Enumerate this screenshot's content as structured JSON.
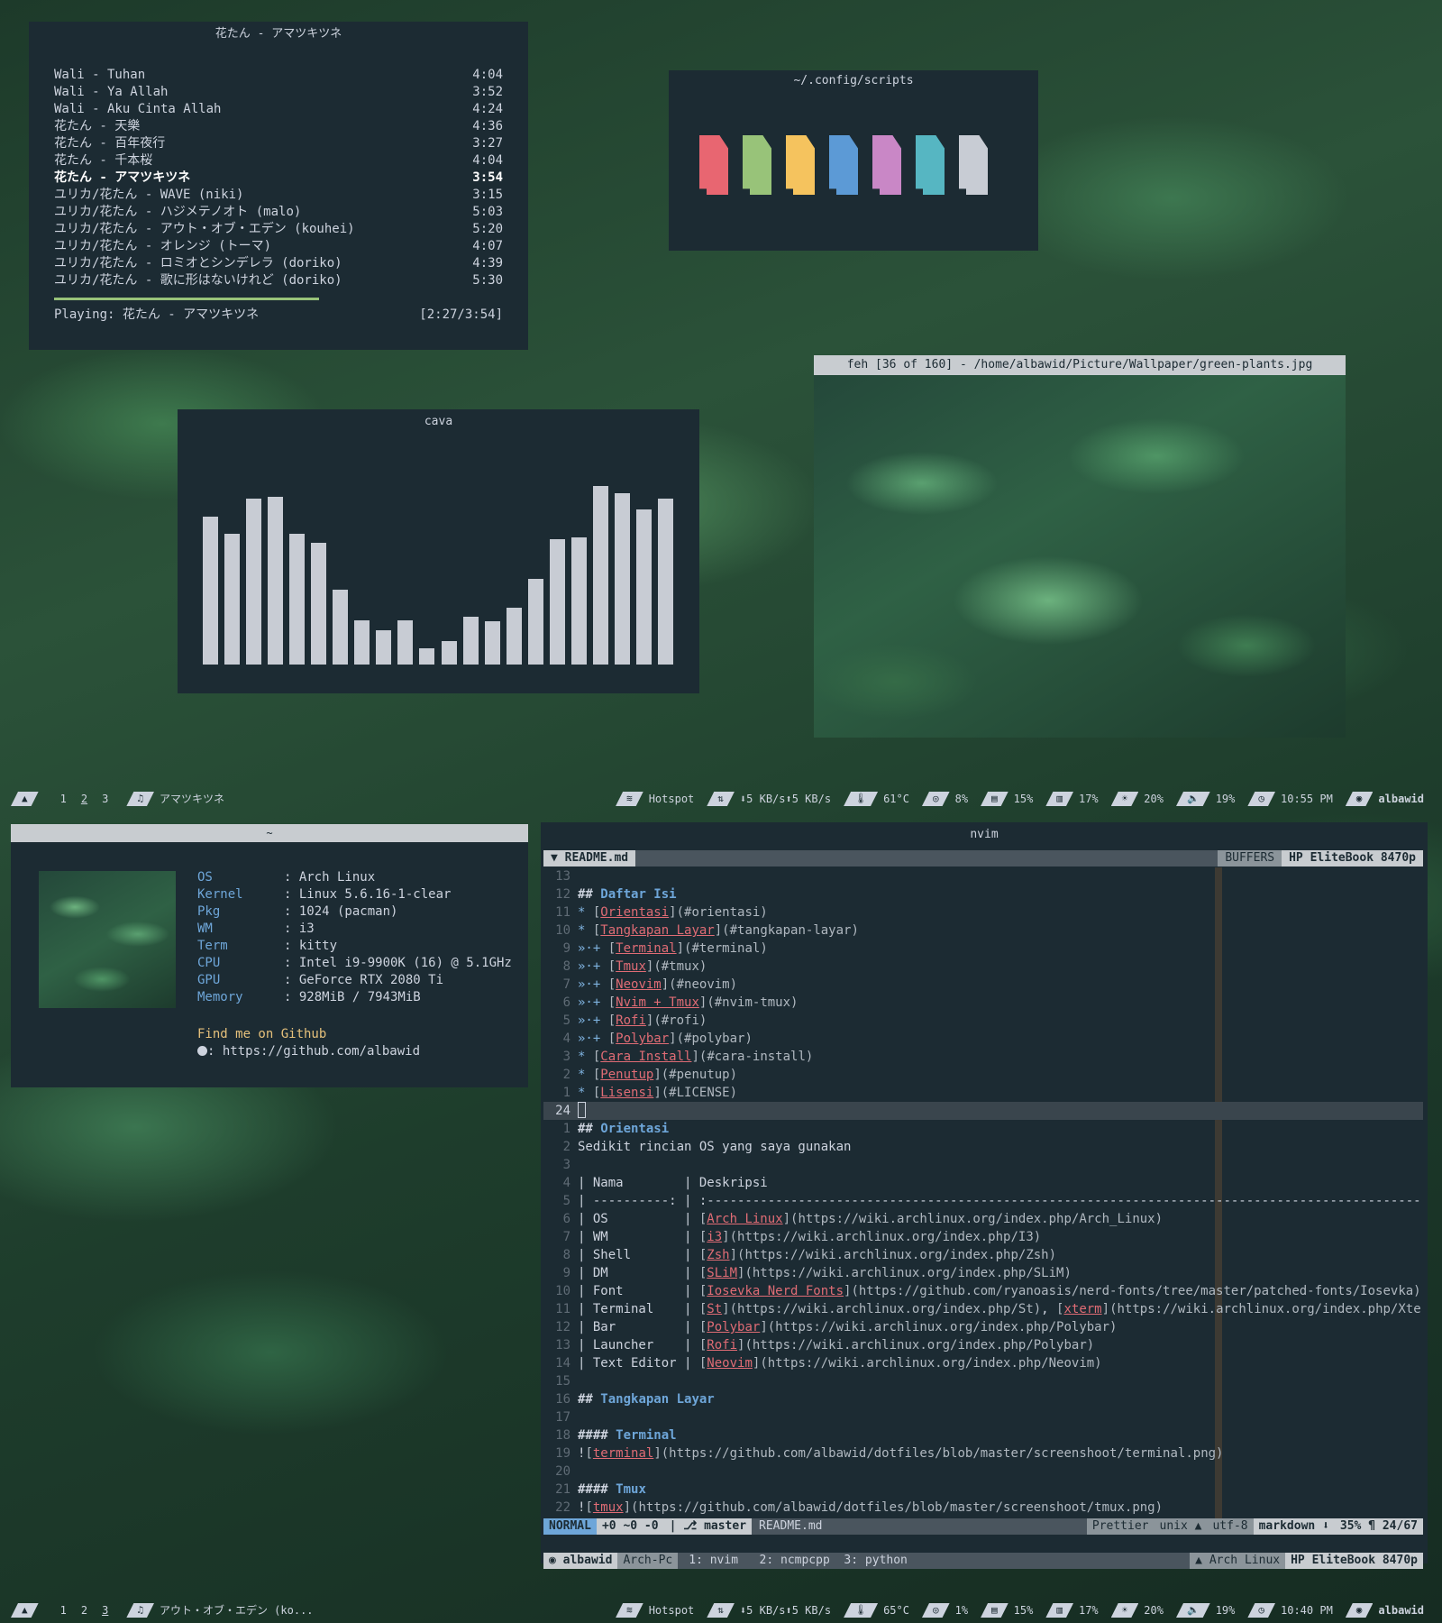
{
  "player": {
    "title": "花たん - アマツキツネ",
    "tracks": [
      {
        "name": "Wali - Tuhan",
        "time": "4:04"
      },
      {
        "name": "Wali - Ya Allah",
        "time": "3:52"
      },
      {
        "name": "Wali - Aku Cinta Allah",
        "time": "4:24"
      },
      {
        "name": "花たん - 天樂",
        "time": "4:36"
      },
      {
        "name": "花たん - 百年夜行",
        "time": "3:27"
      },
      {
        "name": "花たん - 千本桜",
        "time": "4:04"
      },
      {
        "name": "花たん - アマツキツネ",
        "time": "3:54",
        "active": true
      },
      {
        "name": "ユリカ/花たん - WAVE (niki)",
        "time": "3:15"
      },
      {
        "name": "ユリカ/花たん - ハジメテノオト (malo)",
        "time": "5:03"
      },
      {
        "name": "ユリカ/花たん - アウト・オブ・エデン (kouhei)",
        "time": "5:20"
      },
      {
        "name": "ユリカ/花たん - オレンジ (トーマ)",
        "time": "4:07"
      },
      {
        "name": "ユリカ/花たん - ロミオとシンデレラ (doriko)",
        "time": "4:39"
      },
      {
        "name": "ユリカ/花たん - 歌に形はないけれど (doriko)",
        "time": "5:30"
      }
    ],
    "progress": 0.59,
    "playing_label": "Playing: 花たん - アマツキツネ",
    "playing_time": "[2:27/3:54]"
  },
  "scripts": {
    "title": "~/.config/scripts",
    "colors": [
      "#e86671",
      "#98c379",
      "#f5c35e",
      "#5c9ad6",
      "#c987c6",
      "#56b6c2",
      "#c8ccd4"
    ]
  },
  "cava": {
    "title": "cava",
    "levels": [
      0.83,
      0.73,
      0.93,
      0.94,
      0.73,
      0.68,
      0.42,
      0.25,
      0.19,
      0.25,
      0.09,
      0.13,
      0.27,
      0.24,
      0.32,
      0.48,
      0.7,
      0.71,
      1.0,
      0.96,
      0.87,
      0.93
    ]
  },
  "feh": {
    "title": "feh [36 of 160] - /home/albawid/Picture/Wallpaper/green-plants.jpg"
  },
  "topbar": {
    "workspaces": [
      "1",
      "2",
      "3"
    ],
    "active_ws": 1,
    "song": "アマツキツネ",
    "wifi": "Hotspot",
    "down": "5 KB/s",
    "up": "5 KB/s",
    "temp": "61°C",
    "cpu": "8%",
    "mem": "15%",
    "disk": "17%",
    "bright": "20%",
    "vol": "19%",
    "clock": "10:55 PM",
    "user": "albawid"
  },
  "bottombar": {
    "workspaces": [
      "1",
      "2",
      "3"
    ],
    "active_ws": 2,
    "song": "アウト・オブ・エデン (ko...",
    "wifi": "Hotspot",
    "down": "5 KB/s",
    "up": "5 KB/s",
    "temp": "65°C",
    "cpu": "1%",
    "mem": "15%",
    "disk": "17%",
    "bright": "20%",
    "vol": "19%",
    "clock": "10:40 PM",
    "user": "albawid"
  },
  "fetch": {
    "title": "~",
    "rows": [
      {
        "k": "OS",
        "v": ": Arch Linux"
      },
      {
        "k": "Kernel",
        "v": ": Linux 5.6.16-1-clear"
      },
      {
        "k": "Pkg",
        "v": ": 1024 (pacman)"
      },
      {
        "k": "WM",
        "v": ": i3"
      },
      {
        "k": "Term",
        "v": ": kitty"
      },
      {
        "k": "CPU",
        "v": ": Intel i9-9900K (16) @ 5.1GHz"
      },
      {
        "k": "GPU",
        "v": ": GeForce RTX 2080 Ti"
      },
      {
        "k": "Memory",
        "v": ": 928MiB / 7943MiB"
      }
    ],
    "github_label": "Find me on Github",
    "github_url": ": https://github.com/albawid"
  },
  "nvim": {
    "title": "nvim",
    "tab": "README.md",
    "buffers_label": "BUFFERS",
    "host": "HP EliteBook 8470p",
    "lines": [
      {
        "n": "13",
        "t": ""
      },
      {
        "n": "12",
        "t": "## Daftar Isi"
      },
      {
        "n": "11",
        "t": "* [Orientasi](#orientasi)"
      },
      {
        "n": "10",
        "t": "* [Tangkapan Layar](#tangkapan-layar)"
      },
      {
        "n": "9",
        "t": "»·+ [Terminal](#terminal)"
      },
      {
        "n": "8",
        "t": "»·+ [Tmux](#tmux)"
      },
      {
        "n": "7",
        "t": "»·+ [Neovim](#neovim)"
      },
      {
        "n": "6",
        "t": "»·+ [Nvim + Tmux](#nvim-tmux)"
      },
      {
        "n": "5",
        "t": "»·+ [Rofi](#rofi)"
      },
      {
        "n": "4",
        "t": "»·+ [Polybar](#polybar)"
      },
      {
        "n": "3",
        "t": "* [Cara Install](#cara-install)"
      },
      {
        "n": "2",
        "t": "* [Penutup](#penutup)"
      },
      {
        "n": "1",
        "t": "* [Lisensi](#LICENSE)"
      },
      {
        "n": "24",
        "t": "",
        "cur": true
      },
      {
        "n": "1",
        "t": "## Orientasi"
      },
      {
        "n": "2",
        "t": "Sedikit rincian OS yang saya gunakan"
      },
      {
        "n": "3",
        "t": ""
      },
      {
        "n": "4",
        "t": "| Nama        | Deskripsi                                                                                        |"
      },
      {
        "n": "5",
        "t": "| ----------: | :----------------------------------------------------------------------------------------------- |"
      },
      {
        "n": "6",
        "t": "| OS          | [Arch Linux](https://wiki.archlinux.org/index.php/Arch_Linux)                                    |"
      },
      {
        "n": "7",
        "t": "| WM          | [i3](https://wiki.archlinux.org/index.php/I3)                                                    |"
      },
      {
        "n": "8",
        "t": "| Shell       | [Zsh](https://wiki.archlinux.org/index.php/Zsh)                                                  |"
      },
      {
        "n": "9",
        "t": "| DM          | [SLiM](https://wiki.archlinux.org/index.php/SLiM)                                                |"
      },
      {
        "n": "10",
        "t": "| Font        | [Iosevka Nerd Fonts](https://github.com/ryanoasis/nerd-fonts/tree/master/patched-fonts/Iosevka)  |"
      },
      {
        "n": "11",
        "t": "| Terminal    | [St](https://wiki.archlinux.org/index.php/St), [xterm](https://wiki.archlinux.org/index.php/Xterm) |"
      },
      {
        "n": "12",
        "t": "| Bar         | [Polybar](https://wiki.archlinux.org/index.php/Polybar)                                          |"
      },
      {
        "n": "13",
        "t": "| Launcher    | [Rofi](https://wiki.archlinux.org/index.php/Polybar)                                             |"
      },
      {
        "n": "14",
        "t": "| Text Editor | [Neovim](https://wiki.archlinux.org/index.php/Neovim)                                            |"
      },
      {
        "n": "15",
        "t": ""
      },
      {
        "n": "16",
        "t": "## Tangkapan Layar"
      },
      {
        "n": "17",
        "t": ""
      },
      {
        "n": "18",
        "t": "#### Terminal"
      },
      {
        "n": "19",
        "t": "![terminal](https://github.com/albawid/dotfiles/blob/master/screenshoot/terminal.png)"
      },
      {
        "n": "20",
        "t": ""
      },
      {
        "n": "21",
        "t": "#### Tmux"
      },
      {
        "n": "22",
        "t": "![tmux](https://github.com/albawid/dotfiles/blob/master/screenshoot/tmux.png)"
      }
    ],
    "status": {
      "mode": "NORMAL",
      "git": "+0 ~0 -0",
      "branch": "master",
      "file": "README.md",
      "prettier": "Prettier",
      "format": "unix",
      "enc": "utf-8",
      "ft": "markdown",
      "pos": "35%",
      "lines": "24/67"
    }
  },
  "tmux": {
    "user": "albawid",
    "host_short": "Arch-Pc",
    "windows": "1: nvim   2: ncmpcpp  3: python",
    "os": "Arch Linux",
    "host": "HP EliteBook 8470p"
  }
}
